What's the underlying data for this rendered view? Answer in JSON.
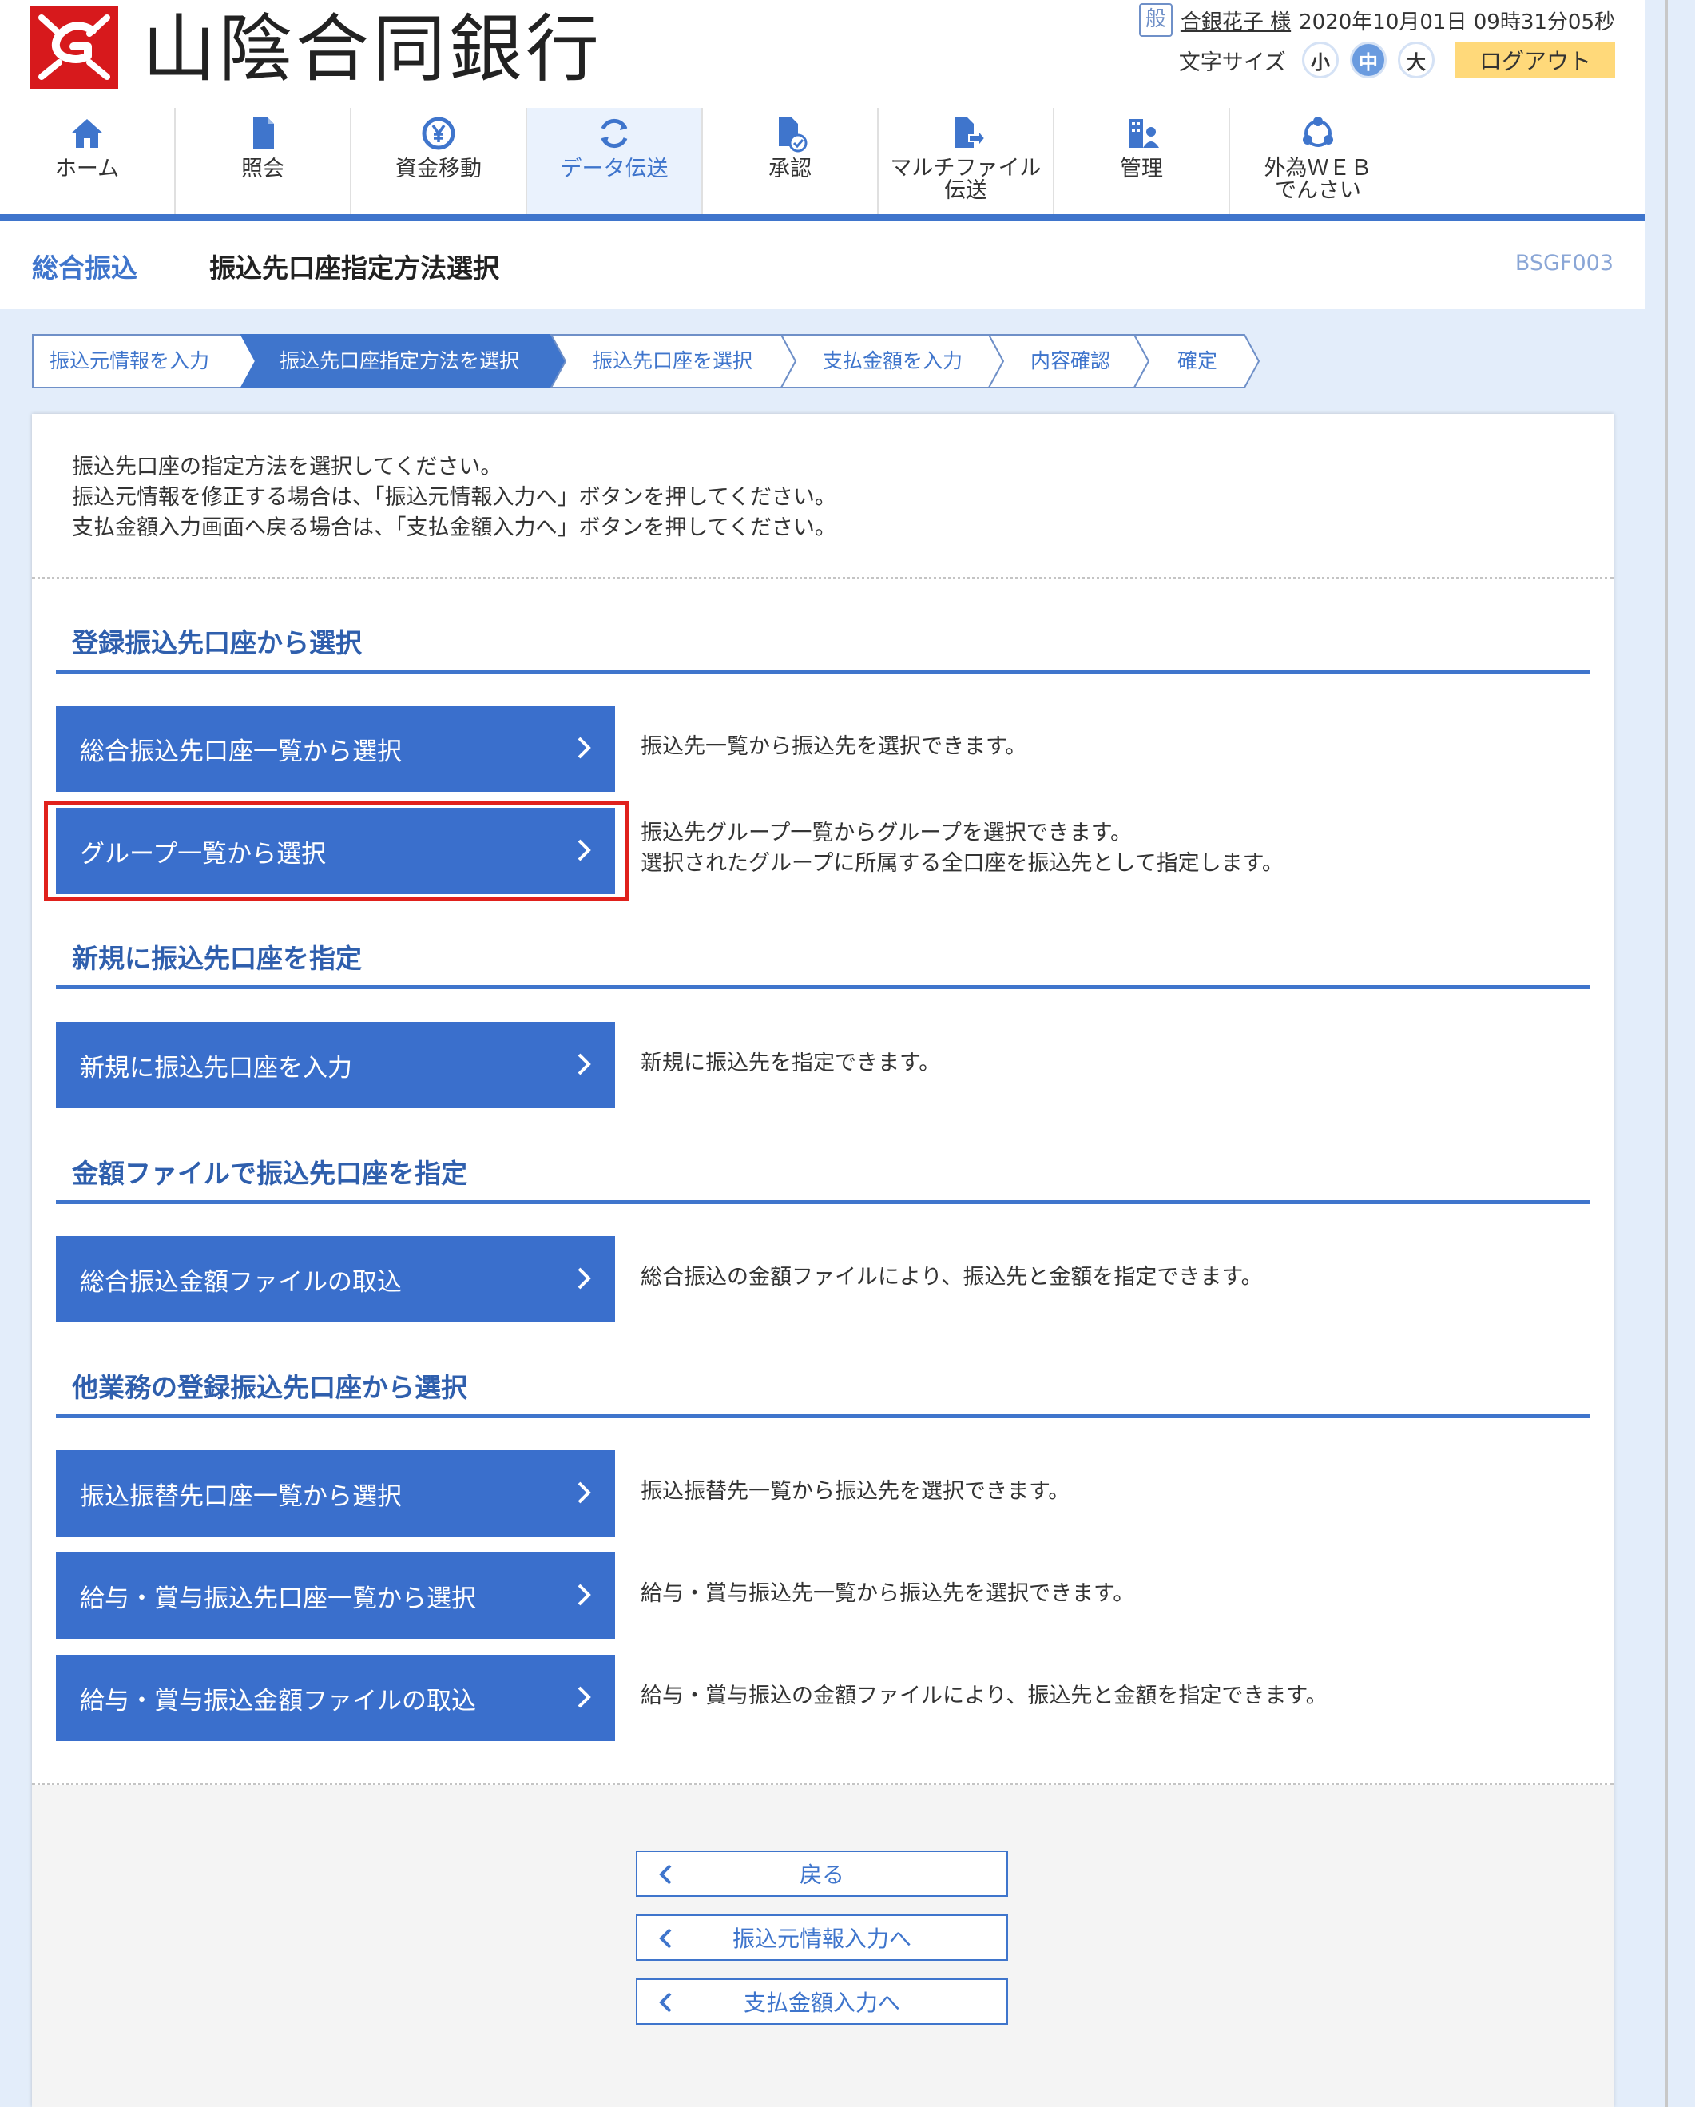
{
  "header": {
    "bank_name": "山陰合同銀行",
    "user_kind_badge": "般",
    "user_name": "合銀花子 様",
    "datetime": "2020年10月01日 09時31分05秒",
    "font_size_label": "文字サイズ",
    "font_sizes": [
      "小",
      "中",
      "大"
    ],
    "active_font_size": "中",
    "logout_label": "ログアウト"
  },
  "nav": {
    "items": [
      {
        "label": "ホーム",
        "icon": "home-icon"
      },
      {
        "label": "照会",
        "icon": "document-icon"
      },
      {
        "label": "資金移動",
        "icon": "yen-transfer-icon"
      },
      {
        "label": "データ伝送",
        "icon": "sync-icon",
        "active": true
      },
      {
        "label": "承認",
        "icon": "approve-document-icon"
      },
      {
        "label": "マルチファイル\n伝送",
        "icon": "file-upload-icon"
      },
      {
        "label": "管理",
        "icon": "admin-building-icon"
      },
      {
        "label": "外為ＷＥＢ\nでんさい",
        "icon": "network-icon"
      }
    ]
  },
  "title": {
    "category": "総合振込",
    "page": "振込先口座指定方法選択",
    "code": "BSGF003"
  },
  "steps": [
    {
      "label": "振込元情報を入力",
      "active": false
    },
    {
      "label": "振込先口座指定方法を選択",
      "active": true
    },
    {
      "label": "振込先口座を選択",
      "active": false
    },
    {
      "label": "支払金額を入力",
      "active": false
    },
    {
      "label": "内容確認",
      "active": false
    },
    {
      "label": "確定",
      "active": false
    }
  ],
  "intro": [
    "振込先口座の指定方法を選択してください。",
    "振込元情報を修正する場合は、「振込元情報入力へ」ボタンを押してください。",
    "支払金額入力画面へ戻る場合は、「支払金額入力へ」ボタンを押してください。"
  ],
  "sections": [
    {
      "heading": "登録振込先口座から選択",
      "actions": [
        {
          "label": "総合振込先口座一覧から選択",
          "desc": [
            "振込先一覧から振込先を選択できます。"
          ]
        },
        {
          "label": "グループ一覧から選択",
          "desc": [
            "振込先グループ一覧からグループを選択できます。",
            "選択されたグループに所属する全口座を振込先として指定します。"
          ],
          "highlighted": true
        }
      ]
    },
    {
      "heading": "新規に振込先口座を指定",
      "actions": [
        {
          "label": "新規に振込先口座を入力",
          "desc": [
            "新規に振込先を指定できます。"
          ]
        }
      ]
    },
    {
      "heading": "金額ファイルで振込先口座を指定",
      "actions": [
        {
          "label": "総合振込金額ファイルの取込",
          "desc": [
            "総合振込の金額ファイルにより、振込先と金額を指定できます。"
          ]
        }
      ]
    },
    {
      "heading": "他業務の登録振込先口座から選択",
      "actions": [
        {
          "label": "振込振替先口座一覧から選択",
          "desc": [
            "振込振替先一覧から振込先を選択できます。"
          ]
        },
        {
          "label": "給与・賞与振込先口座一覧から選択",
          "desc": [
            "給与・賞与振込先一覧から振込先を選択できます。"
          ]
        },
        {
          "label": "給与・賞与振込金額ファイルの取込",
          "desc": [
            "給与・賞与振込の金額ファイルにより、振込先と金額を指定できます。"
          ]
        }
      ]
    }
  ],
  "footer_buttons": [
    "戻る",
    "振込元情報入力へ",
    "支払金額入力へ"
  ],
  "colors": {
    "primary": "#3a6fcc",
    "nav_bar": "#3f75cc",
    "logout": "#ffd97a",
    "highlight": "#e0211c",
    "logo_red": "#d7191c",
    "background": "#e3edfa"
  }
}
